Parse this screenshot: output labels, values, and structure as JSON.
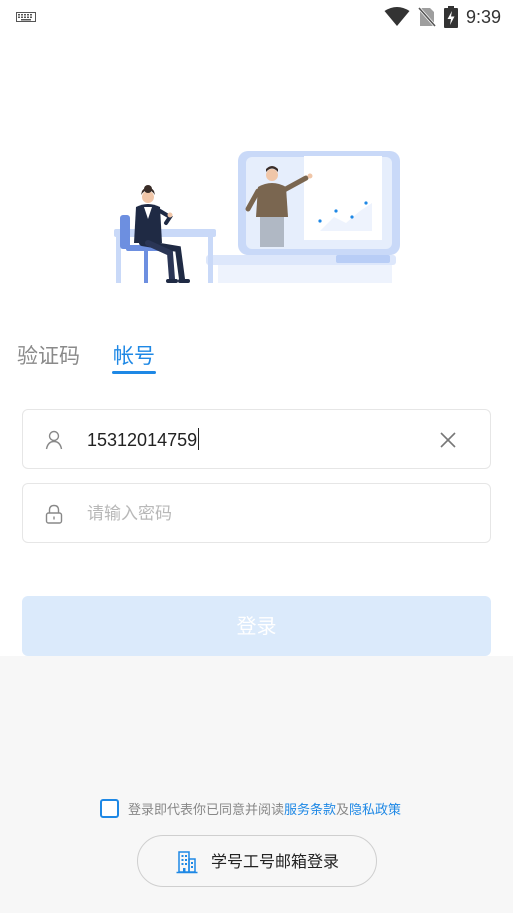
{
  "status_bar": {
    "time": "9:39",
    "icons": [
      "keyboard-icon",
      "wifi-icon",
      "no-sim-icon",
      "battery-charging-icon"
    ]
  },
  "tabs": [
    {
      "label": "验证码",
      "active": false
    },
    {
      "label": "帐号",
      "active": true
    }
  ],
  "account_field": {
    "value": "15312014759",
    "icon": "user-icon",
    "clear_icon": "close-icon"
  },
  "password_field": {
    "placeholder": "请输入密码",
    "icon": "lock-icon"
  },
  "login_button": {
    "label": "登录",
    "enabled": false
  },
  "agreement": {
    "prefix": "登录即代表你已同意并阅读",
    "terms_link": "服务条款",
    "conjunction": "及",
    "privacy_link": "隐私政策",
    "checked": false
  },
  "alt_login": {
    "label": "学号工号邮箱登录",
    "icon": "building-icon"
  },
  "colors": {
    "accent": "#1e88e5",
    "button_disabled": "#dbeafb",
    "bottom_panel": "#f7f7f7"
  }
}
